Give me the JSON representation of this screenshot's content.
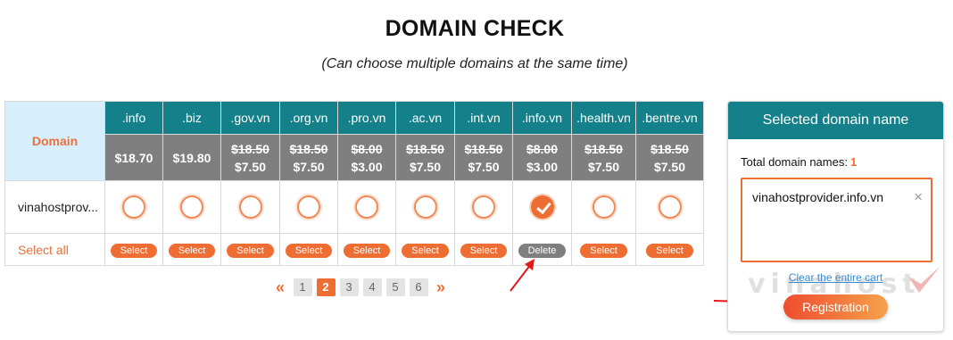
{
  "title": "DOMAIN CHECK",
  "subtitle": "(Can choose multiple domains at the same time)",
  "table": {
    "domain_header": "Domain",
    "select_all": "Select all",
    "domain_name": "vinahostprov...",
    "extensions": [
      {
        "ext": ".info",
        "price_only": "$18.70",
        "selected": false,
        "action": "Select"
      },
      {
        "ext": ".biz",
        "price_only": "$19.80",
        "selected": false,
        "action": "Select"
      },
      {
        "ext": ".gov.vn",
        "old_price": "$18.50",
        "new_price": "$7.50",
        "selected": false,
        "action": "Select"
      },
      {
        "ext": ".org.vn",
        "old_price": "$18.50",
        "new_price": "$7.50",
        "selected": false,
        "action": "Select"
      },
      {
        "ext": ".pro.vn",
        "old_price": "$8.00",
        "new_price": "$3.00",
        "selected": false,
        "action": "Select"
      },
      {
        "ext": ".ac.vn",
        "old_price": "$18.50",
        "new_price": "$7.50",
        "selected": false,
        "action": "Select"
      },
      {
        "ext": ".int.vn",
        "old_price": "$18.50",
        "new_price": "$7.50",
        "selected": false,
        "action": "Select"
      },
      {
        "ext": ".info.vn",
        "old_price": "$8.00",
        "new_price": "$3.00",
        "selected": true,
        "action": "Delete"
      },
      {
        "ext": ".health.vn",
        "old_price": "$18.50",
        "new_price": "$7.50",
        "selected": false,
        "action": "Select"
      },
      {
        "ext": ".bentre.vn",
        "old_price": "$18.50",
        "new_price": "$7.50",
        "selected": false,
        "action": "Select"
      }
    ]
  },
  "pagination": {
    "prev": "«",
    "next": "»",
    "pages": [
      "1",
      "2",
      "3",
      "4",
      "5",
      "6"
    ],
    "current": "2"
  },
  "panel": {
    "title": "Selected domain name",
    "count_label": "Total domain names:",
    "count": "1",
    "items": [
      "vinahostprovider.info.vn"
    ],
    "remove_icon": "×",
    "clear_label": "Clear the entire cart",
    "register_label": "Registration",
    "watermark": "vinahost"
  },
  "colors": {
    "accent": "#ee6d32",
    "header_teal": "#13808a",
    "price_gray": "#7f7f7f",
    "domain_label_bg": "#d7eefc",
    "annotation_red": "#e0191b"
  }
}
